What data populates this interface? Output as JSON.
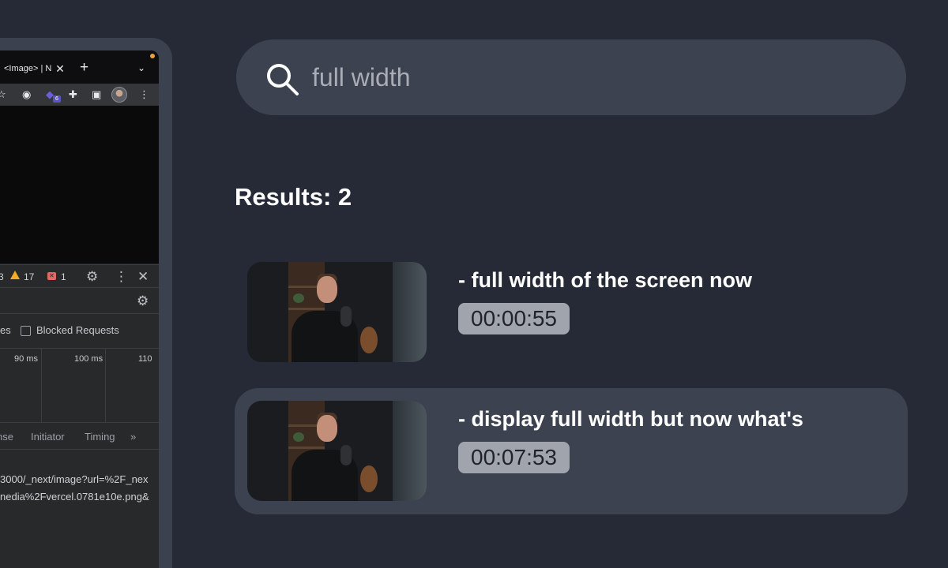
{
  "browser": {
    "tab_title": "<Image> | N",
    "extension_badge": "6",
    "devtools": {
      "count_hidden": "3",
      "warnings": "17",
      "errors": "1",
      "blocked_requests_label": "Blocked Requests",
      "partial_label": "es",
      "ticks": [
        "90 ms",
        "100 ms",
        "110"
      ],
      "tabs": [
        "nse",
        "Initiator",
        "Timing"
      ],
      "url_lines": [
        "3000/_next/image?url=%2F_nex",
        "nedia%2Fvercel.0781e10e.png&"
      ]
    }
  },
  "search": {
    "value": "full width",
    "placeholder": "Search"
  },
  "results": {
    "heading": "Results: 2",
    "items": [
      {
        "title": "- full width of the screen now",
        "time": "00:00:55"
      },
      {
        "title": "- display full width but now what's",
        "time": "00:07:53"
      }
    ]
  }
}
